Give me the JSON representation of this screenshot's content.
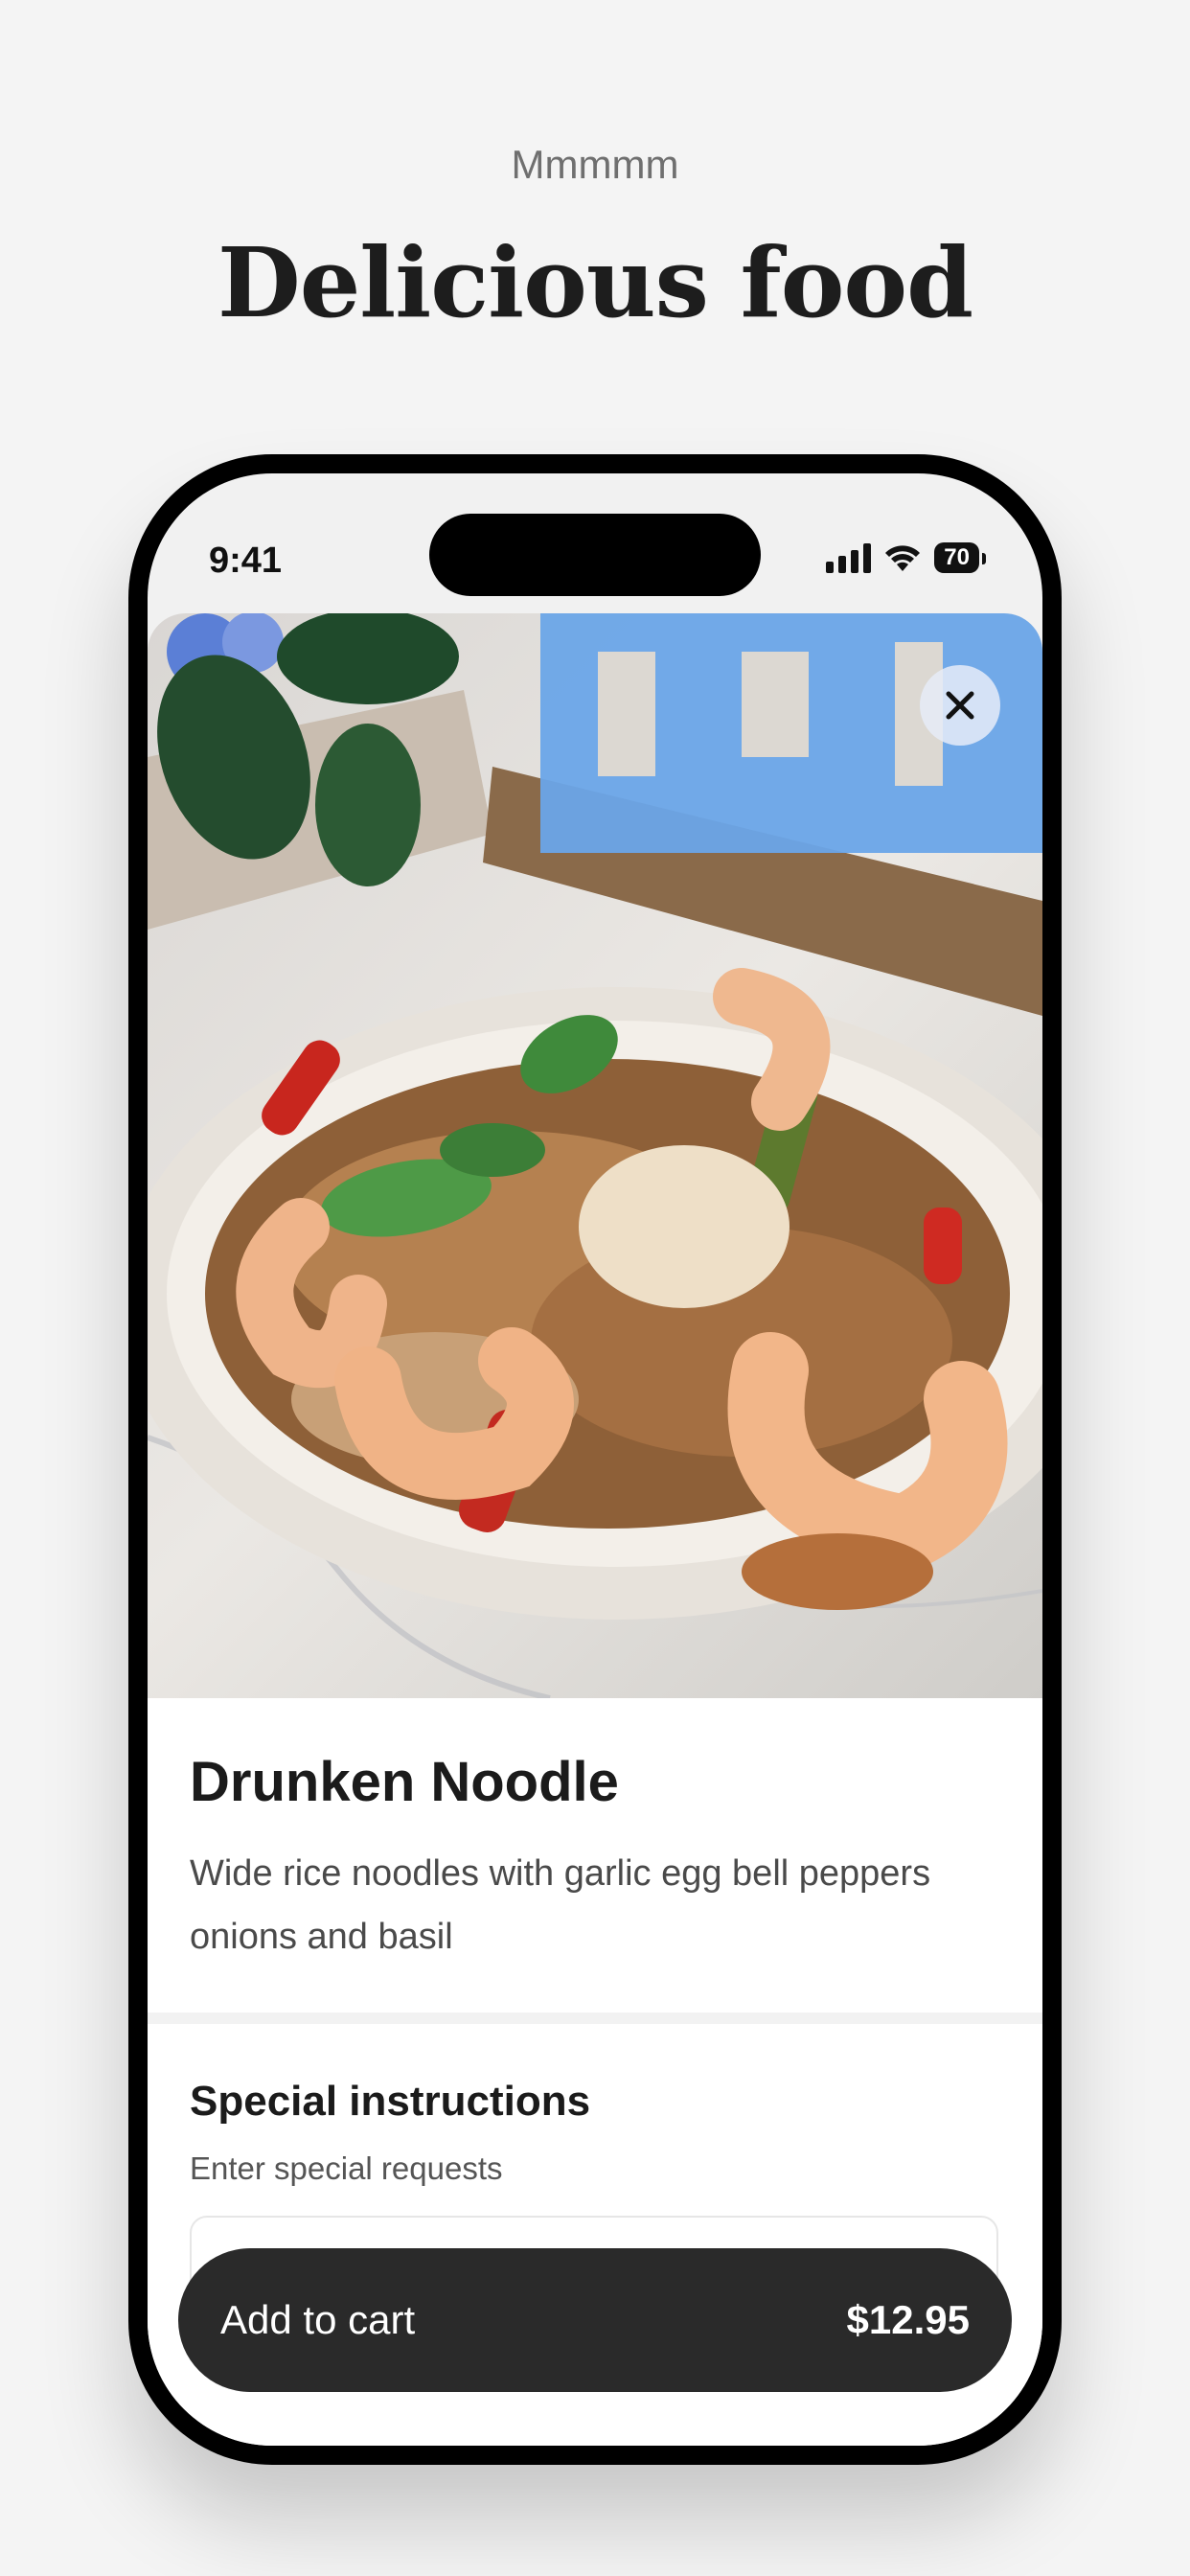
{
  "header": {
    "eyebrow": "Mmmmm",
    "headline": "Delicious food"
  },
  "status_bar": {
    "time": "9:41",
    "battery": "70"
  },
  "photo": {
    "subject": "drunken-noodle-dish-photo",
    "close_icon": "close-icon"
  },
  "item": {
    "title": "Drunken Noodle",
    "description": "Wide rice noodles with garlic egg bell peppers onions and basil"
  },
  "instructions": {
    "title": "Special instructions",
    "subtitle": "Enter special requests",
    "input_value": ""
  },
  "cart": {
    "label": "Add to cart",
    "price": "$12.95"
  },
  "colors": {
    "background": "#f4f4f4",
    "button": "#2a2a2a",
    "close_button": "#e6ecf8"
  }
}
